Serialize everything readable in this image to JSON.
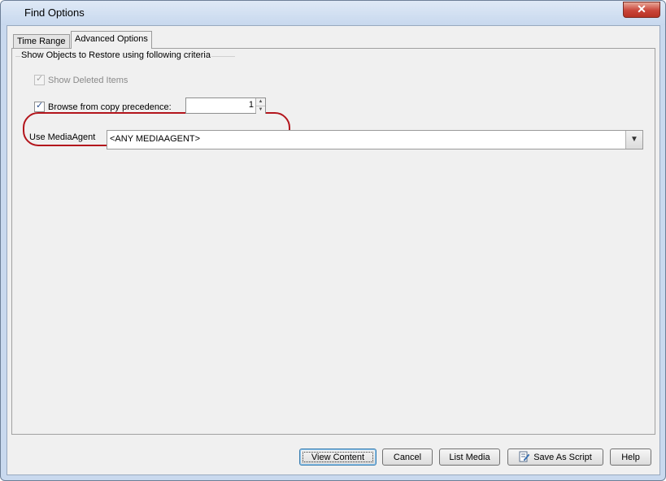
{
  "window": {
    "title": "Find Options",
    "close_glyph": "✕"
  },
  "tabs": [
    {
      "label": "Time Range"
    },
    {
      "label": "Advanced Options"
    }
  ],
  "group": {
    "title": "Show Objects to Restore using following criteria"
  },
  "options": {
    "show_deleted_label": "Show Deleted Items",
    "show_deleted_checked": true,
    "show_deleted_enabled": false,
    "browse_copy_label": "Browse from copy precedence:",
    "browse_copy_checked": true,
    "copy_precedence_value": "1"
  },
  "media_agent": {
    "label": "Use MediaAgent",
    "selected": "<ANY MEDIAAGENT>"
  },
  "buttons": {
    "view_content": "View Content",
    "cancel": "Cancel",
    "list_media": "List Media",
    "save_as_script": "Save As Script",
    "help": "Help"
  },
  "icons": {
    "checkbox_tick": "✓",
    "spin_up": "▲",
    "spin_down": "▼",
    "combo_arrow": "▼",
    "save_script": "script-icon"
  },
  "colors": {
    "highlight": "#b3151c",
    "close_button": "#c9453a",
    "title_bar": "#c9d9ee"
  }
}
